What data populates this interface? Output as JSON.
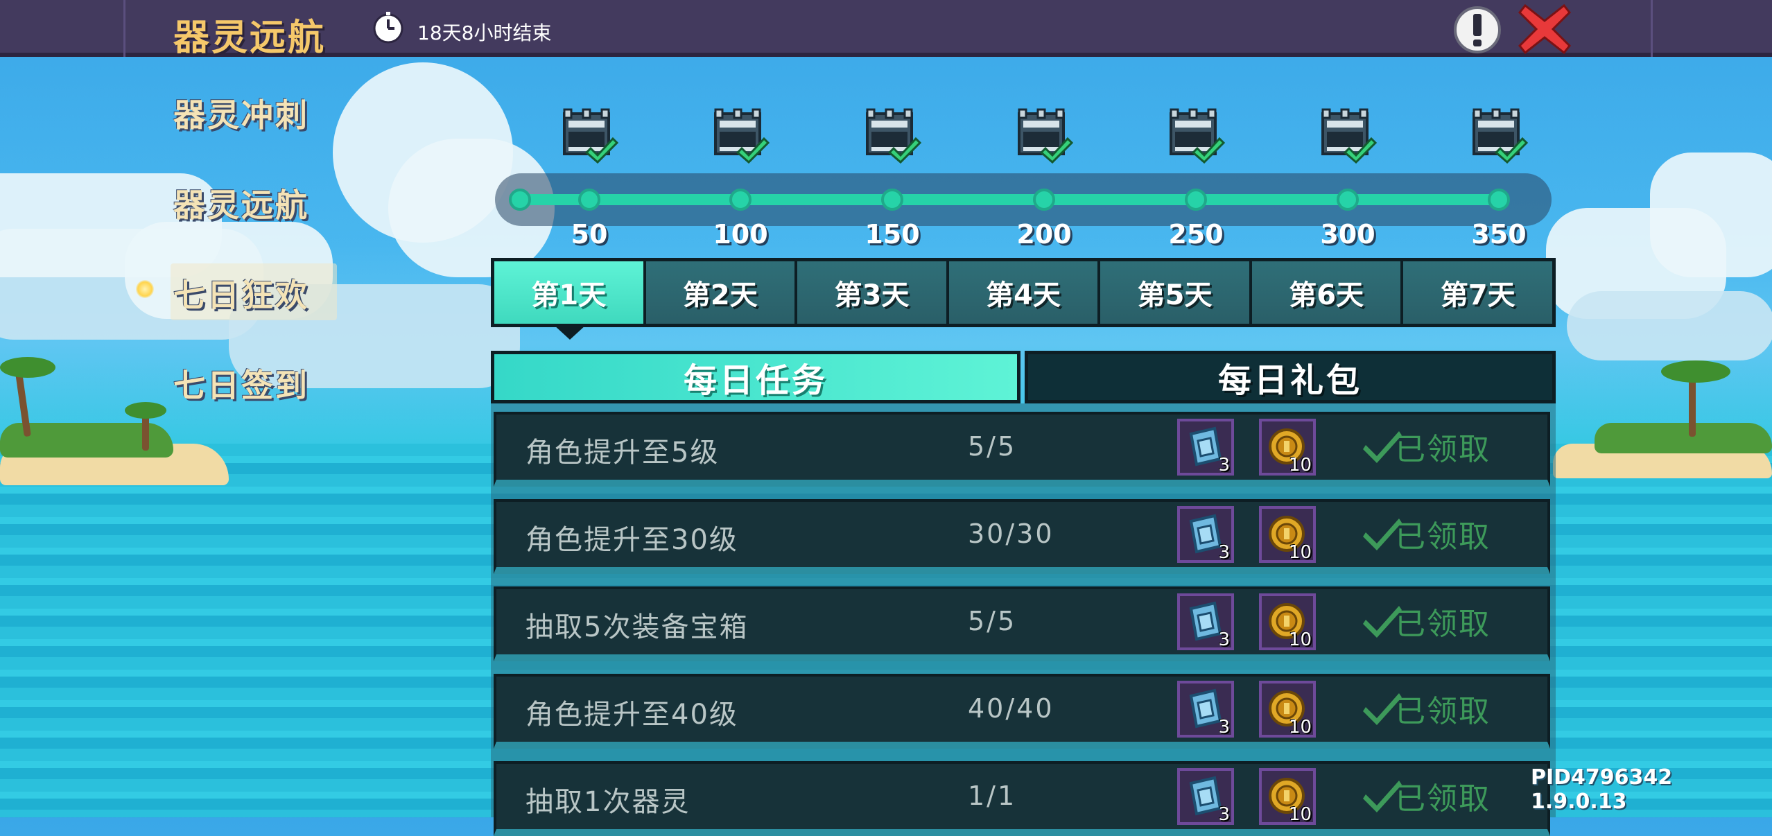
{
  "header": {
    "title": "器灵远航",
    "countdown": "18天8小时结束",
    "icons": {
      "clock": "clock-icon",
      "info": "exclamation-icon",
      "close": "close-icon"
    }
  },
  "menu": {
    "items": [
      {
        "label": "器灵冲刺",
        "active": false
      },
      {
        "label": "器灵远航",
        "active": false
      },
      {
        "label": "七日狂欢",
        "active": true
      },
      {
        "label": "七日签到",
        "active": false
      }
    ]
  },
  "progress": {
    "milestones": [
      "50",
      "100",
      "150",
      "200",
      "250",
      "300",
      "350"
    ],
    "current": 350,
    "chests_claimed": 7
  },
  "day_tabs": {
    "items": [
      "第1天",
      "第2天",
      "第3天",
      "第4天",
      "第5天",
      "第6天",
      "第7天"
    ],
    "selected": 0
  },
  "sub_tabs": {
    "daily": "每日任务",
    "gift": "每日礼包",
    "selected": "daily"
  },
  "tasks": [
    {
      "name": "角色提升至5级",
      "progress": "5/5",
      "reward1": "3",
      "reward2": "10",
      "status": "已领取"
    },
    {
      "name": "角色提升至30级",
      "progress": "30/30",
      "reward1": "3",
      "reward2": "10",
      "status": "已领取"
    },
    {
      "name": "抽取5次装备宝箱",
      "progress": "5/5",
      "reward1": "3",
      "reward2": "10",
      "status": "已领取"
    },
    {
      "name": "角色提升至40级",
      "progress": "40/40",
      "reward1": "3",
      "reward2": "10",
      "status": "已领取"
    },
    {
      "name": "抽取1次器灵",
      "progress": "1/1",
      "reward1": "3",
      "reward2": "10",
      "status": "已领取"
    }
  ],
  "reward_icons": [
    "blue-card-icon",
    "gold-coin-icon"
  ],
  "footer": {
    "pid": "PID4796342 1.9.0.13"
  },
  "colors": {
    "accent": "#3fd9be",
    "title": "#f5c86a",
    "claimed": "#3d9a5a",
    "topbar": "#433a5e"
  }
}
